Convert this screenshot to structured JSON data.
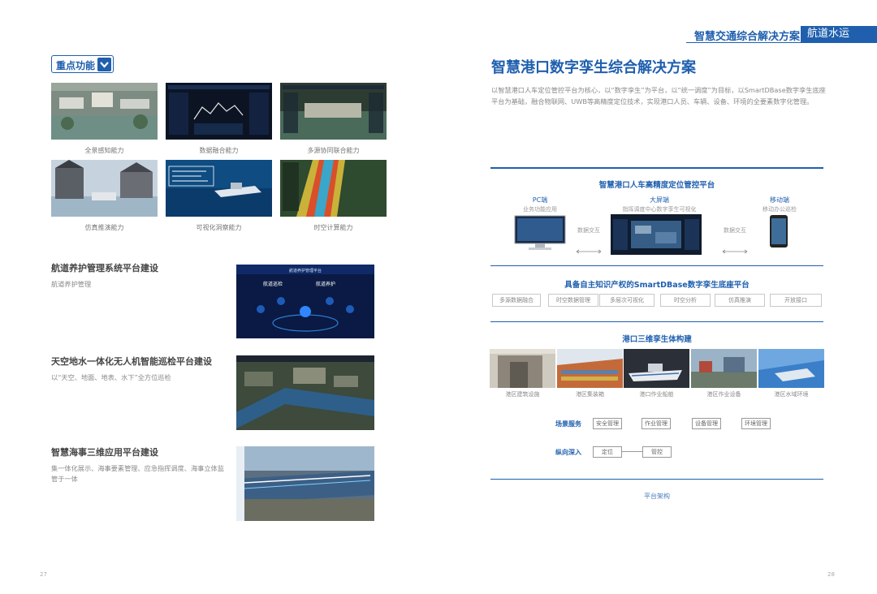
{
  "header": {
    "title": "智慧交通综合解决方案",
    "tab": "航道水运"
  },
  "left": {
    "key_functions": "重点功能",
    "captions": [
      "全景感知能力",
      "数据融合能力",
      "多源协同联合能力",
      "仿真推演能力",
      "可视化洞察能力",
      "时空计算能力"
    ],
    "sections": [
      {
        "title": "航道养护管理系统平台建设",
        "body": "航道养护管理"
      },
      {
        "title": "天空地水一体化无人机智能巡检平台建设",
        "body": "以“天空、地面、地表、水下”全方位巡检"
      },
      {
        "title": "智慧海事三维应用平台建设",
        "body": "集一体化展示、海事要素管理、应急指挥调度、海事立体监管于一体"
      }
    ],
    "page_no": "27",
    "panel_title": "航道养护管理平台",
    "panel_tag_1": "航道巡检",
    "panel_tag_2": "航道养护"
  },
  "right": {
    "title": "智慧港口数字孪生综合解决方案",
    "body": "以智慧港口人车定位管控平台为核心，以“数字孪生”为平台，以“统一调度”为目标，以SmartDBase数字孪生底座平台为基础，融合物联网、UWB等高精度定位技术，实现港口人员、车辆、设备、环境的全要素数字化管理。",
    "diagram": {
      "top_title": "智慧港口人车高精度定位管控平台",
      "pc_label": "PC端",
      "pc_sub": "业务功能应用",
      "big_label": "大屏端",
      "big_sub": "指挥调度中心数字孪生可视化",
      "mobile_label": "移动端",
      "mobile_sub": "移动办公巡检",
      "arrow_left": "数据交互",
      "arrow_right": "数据交互",
      "base_title": "具备自主知识产权的SmartDBase数字孪生底座平台",
      "functions": [
        "多源数据融合",
        "时空数据管理",
        "多层次可视化",
        "时空分析",
        "仿真推演",
        "开放接口"
      ],
      "twin_title": "港口三维孪生体构建",
      "twins": [
        "港区建筑设施",
        "港区集装箱",
        "港口作业船舶",
        "港区作业设备",
        "港区水域环境"
      ],
      "row1_label": "场景服务",
      "row1_items": [
        "安全管理",
        "作业管理",
        "设备管理",
        "环境管理"
      ],
      "row2_label": "纵向深入",
      "row2_items": [
        "定位",
        "管控"
      ],
      "footer": "平台架构"
    },
    "page_no": "28"
  }
}
